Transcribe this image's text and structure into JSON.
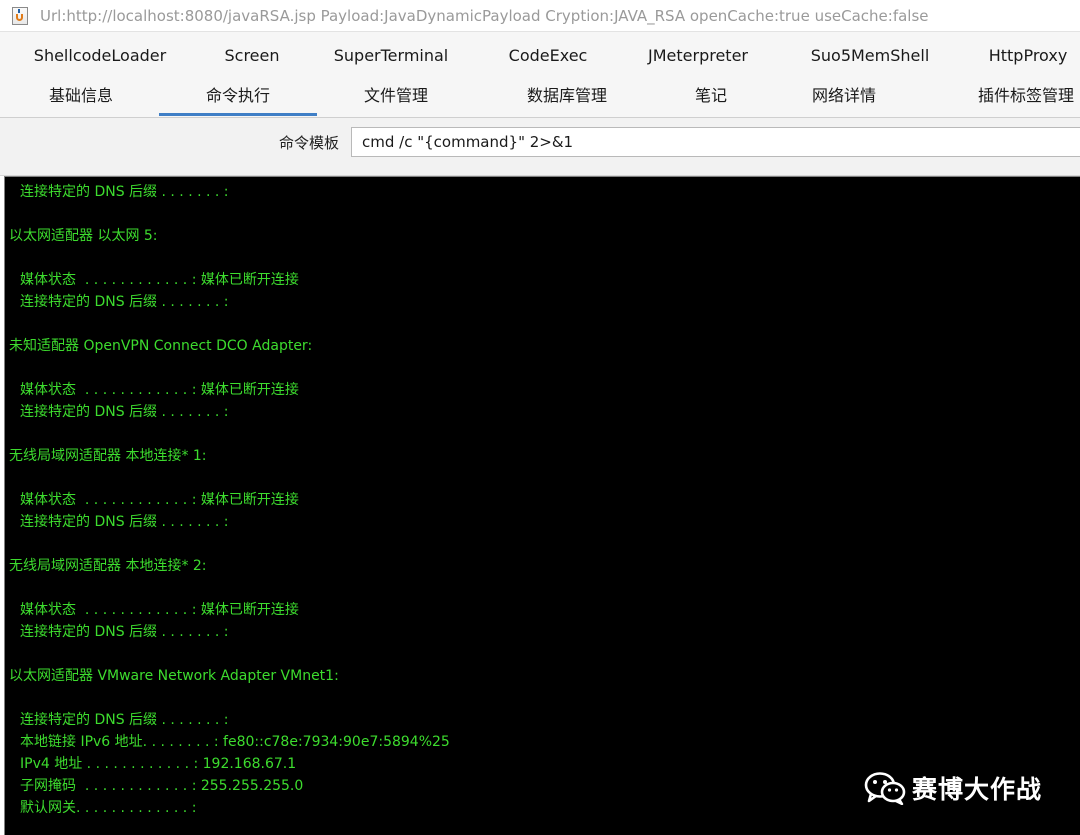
{
  "window": {
    "title": "Url:http://localhost:8080/javaRSA.jsp Payload:JavaDynamicPayload Cryption:JAVA_RSA openCache:true useCache:false"
  },
  "tabs": {
    "row1": [
      "ShellcodeLoader",
      "Screen",
      "SuperTerminal",
      "CodeExec",
      "JMeterpreter",
      "Suo5MemShell",
      "HttpProxy"
    ],
    "row2": [
      "基础信息",
      "命令执行",
      "文件管理",
      "数据库管理",
      "笔记",
      "网络详情",
      "插件标签管理"
    ],
    "active": "命令执行"
  },
  "command": {
    "label": "命令模板",
    "value": "cmd /c \"{command}\" 2>&1"
  },
  "terminal": {
    "text_color": "#3ddc2e",
    "background": "#000000",
    "lines": [
      "连接特定的 DNS 后缀 . . . . . . . :",
      "",
      "以太网适配器 以太网 5:",
      "",
      "媒体状态  . . . . . . . . . . . . : 媒体已断开连接",
      "连接特定的 DNS 后缀 . . . . . . . :",
      "",
      "未知适配器 OpenVPN Connect DCO Adapter:",
      "",
      "媒体状态  . . . . . . . . . . . . : 媒体已断开连接",
      "连接特定的 DNS 后缀 . . . . . . . :",
      "",
      "无线局域网适配器 本地连接* 1:",
      "",
      "媒体状态  . . . . . . . . . . . . : 媒体已断开连接",
      "连接特定的 DNS 后缀 . . . . . . . :",
      "",
      "无线局域网适配器 本地连接* 2:",
      "",
      "媒体状态  . . . . . . . . . . . . : 媒体已断开连接",
      "连接特定的 DNS 后缀 . . . . . . . :",
      "",
      "以太网适配器 VMware Network Adapter VMnet1:",
      "",
      "连接特定的 DNS 后缀 . . . . . . . :",
      "本地链接 IPv6 地址. . . . . . . . : fe80::c78e:7934:90e7:5894%25",
      "IPv4 地址 . . . . . . . . . . . . : 192.168.67.1",
      "子网掩码  . . . . . . . . . . . . : 255.255.255.0",
      "默认网关. . . . . . . . . . . . . :"
    ],
    "indented": [
      true,
      false,
      false,
      false,
      true,
      true,
      false,
      false,
      false,
      true,
      true,
      false,
      false,
      false,
      true,
      true,
      false,
      false,
      false,
      true,
      true,
      false,
      false,
      false,
      true,
      true,
      true,
      true,
      true
    ]
  },
  "watermark": {
    "icon": "wechat-icon",
    "text": "赛博大作战"
  }
}
